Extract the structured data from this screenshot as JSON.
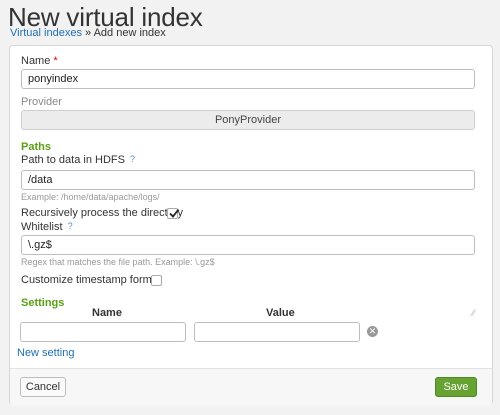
{
  "header": {
    "title": "New virtual index",
    "breadcrumb_link": "Virtual indexes",
    "breadcrumb_separator": "»",
    "breadcrumb_current": "Add new index"
  },
  "form": {
    "name": {
      "label": "Name",
      "required_marker": "*",
      "value": "ponyindex"
    },
    "provider": {
      "label": "Provider",
      "value": "PonyProvider"
    },
    "paths_section": "Paths",
    "path_to_data": {
      "label": "Path to data in HDFS",
      "help_marker": "?",
      "value": "/data",
      "example": "Example: /home/data/apache/logs/"
    },
    "recursive": {
      "label": "Recursively process the directory",
      "checked": true
    },
    "whitelist": {
      "label": "Whitelist",
      "help_marker": "?",
      "value": "\\.gz$",
      "hint": "Regex that matches the file path. Example: \\.gz$"
    },
    "timestamp": {
      "label": "Customize timestamp format",
      "checked": false
    },
    "settings_section": "Settings",
    "settings_columns": {
      "name": "Name",
      "value": "Value"
    },
    "settings_rows": [
      {
        "name": "",
        "value": ""
      }
    ],
    "new_setting_label": "New setting"
  },
  "footer": {
    "cancel_label": "Cancel",
    "save_label": "Save"
  },
  "colors": {
    "accent_green": "#5a9f16",
    "link_blue": "#1f6fb2",
    "save_button": "#67a332"
  },
  "icons": {
    "remove": "remove-circle-icon",
    "check": "checkmark-icon",
    "help": "question-mark-icon"
  }
}
